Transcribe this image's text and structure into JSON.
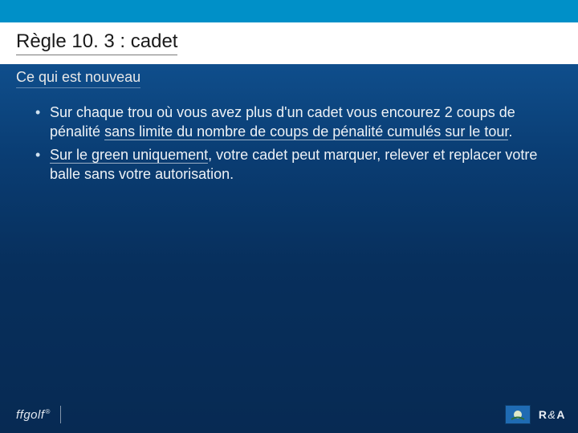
{
  "title": "Règle 10. 3 : cadet",
  "subtitle": "Ce qui est nouveau",
  "bullets": [
    {
      "pre": "Sur chaque trou où vous avez plus d'un cadet vous encourez 2 coups de pénalité ",
      "u": "sans limite du nombre de coups de pénalité cumulés sur le tour",
      "post": "."
    },
    {
      "pre": "",
      "u": "Sur le green uniquement",
      "post": ", votre cadet peut marquer, relever et replacer votre balle sans votre autorisation."
    }
  ],
  "footer": {
    "left": "ffgolf",
    "right": "R&A"
  }
}
